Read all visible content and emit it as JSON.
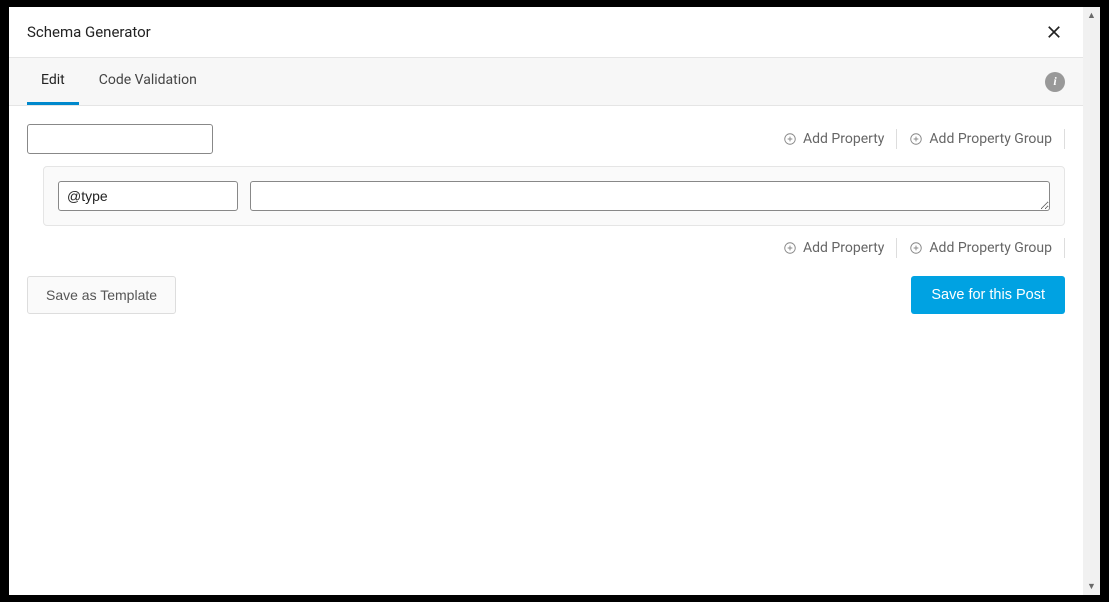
{
  "header": {
    "title": "Schema Generator"
  },
  "tabs": {
    "edit": "Edit",
    "code_validation": "Code Validation"
  },
  "actions": {
    "add_property": "Add Property",
    "add_property_group": "Add Property Group"
  },
  "editor": {
    "group_name_value": "",
    "property_key_value": "@type",
    "property_value_value": ""
  },
  "footer": {
    "save_template": "Save as Template",
    "save_post": "Save for this Post"
  }
}
